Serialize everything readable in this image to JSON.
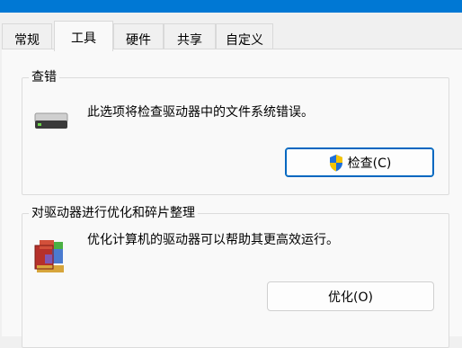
{
  "tabs": [
    {
      "label": "常规",
      "active": false
    },
    {
      "label": "工具",
      "active": true
    },
    {
      "label": "硬件",
      "active": false
    },
    {
      "label": "共享",
      "active": false
    },
    {
      "label": "自定义",
      "active": false
    }
  ],
  "error_check": {
    "title": "查错",
    "description": "此选项将检查驱动器中的文件系统错误。",
    "icon": "hard-drive-icon",
    "button_label": "检查(C)",
    "button_icon": "uac-shield-icon"
  },
  "optimize": {
    "title": "对驱动器进行优化和碎片整理",
    "description": "优化计算机的驱动器可以帮助其更高效运行。",
    "icon": "defrag-icon",
    "button_label": "优化(O)"
  },
  "colors": {
    "accent": "#0078d4",
    "focus_border": "#0067c0",
    "shield_blue": "#1e6fd9",
    "shield_yellow": "#f5c400"
  }
}
